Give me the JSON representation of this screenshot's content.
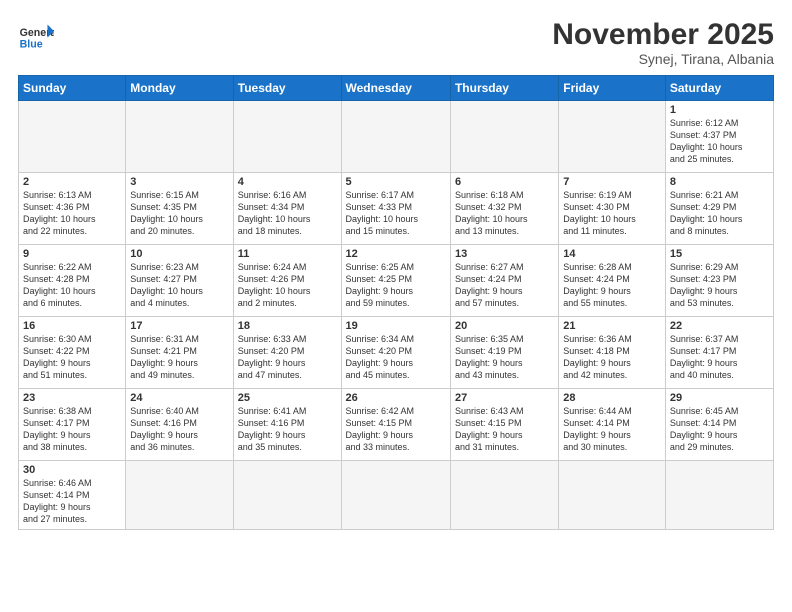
{
  "logo": {
    "line1": "General",
    "line2": "Blue"
  },
  "title": "November 2025",
  "location": "Synej, Tirana, Albania",
  "weekdays": [
    "Sunday",
    "Monday",
    "Tuesday",
    "Wednesday",
    "Thursday",
    "Friday",
    "Saturday"
  ],
  "weeks": [
    [
      {
        "day": "",
        "info": ""
      },
      {
        "day": "",
        "info": ""
      },
      {
        "day": "",
        "info": ""
      },
      {
        "day": "",
        "info": ""
      },
      {
        "day": "",
        "info": ""
      },
      {
        "day": "",
        "info": ""
      },
      {
        "day": "1",
        "info": "Sunrise: 6:12 AM\nSunset: 4:37 PM\nDaylight: 10 hours\nand 25 minutes."
      }
    ],
    [
      {
        "day": "2",
        "info": "Sunrise: 6:13 AM\nSunset: 4:36 PM\nDaylight: 10 hours\nand 22 minutes."
      },
      {
        "day": "3",
        "info": "Sunrise: 6:15 AM\nSunset: 4:35 PM\nDaylight: 10 hours\nand 20 minutes."
      },
      {
        "day": "4",
        "info": "Sunrise: 6:16 AM\nSunset: 4:34 PM\nDaylight: 10 hours\nand 18 minutes."
      },
      {
        "day": "5",
        "info": "Sunrise: 6:17 AM\nSunset: 4:33 PM\nDaylight: 10 hours\nand 15 minutes."
      },
      {
        "day": "6",
        "info": "Sunrise: 6:18 AM\nSunset: 4:32 PM\nDaylight: 10 hours\nand 13 minutes."
      },
      {
        "day": "7",
        "info": "Sunrise: 6:19 AM\nSunset: 4:30 PM\nDaylight: 10 hours\nand 11 minutes."
      },
      {
        "day": "8",
        "info": "Sunrise: 6:21 AM\nSunset: 4:29 PM\nDaylight: 10 hours\nand 8 minutes."
      }
    ],
    [
      {
        "day": "9",
        "info": "Sunrise: 6:22 AM\nSunset: 4:28 PM\nDaylight: 10 hours\nand 6 minutes."
      },
      {
        "day": "10",
        "info": "Sunrise: 6:23 AM\nSunset: 4:27 PM\nDaylight: 10 hours\nand 4 minutes."
      },
      {
        "day": "11",
        "info": "Sunrise: 6:24 AM\nSunset: 4:26 PM\nDaylight: 10 hours\nand 2 minutes."
      },
      {
        "day": "12",
        "info": "Sunrise: 6:25 AM\nSunset: 4:25 PM\nDaylight: 9 hours\nand 59 minutes."
      },
      {
        "day": "13",
        "info": "Sunrise: 6:27 AM\nSunset: 4:24 PM\nDaylight: 9 hours\nand 57 minutes."
      },
      {
        "day": "14",
        "info": "Sunrise: 6:28 AM\nSunset: 4:24 PM\nDaylight: 9 hours\nand 55 minutes."
      },
      {
        "day": "15",
        "info": "Sunrise: 6:29 AM\nSunset: 4:23 PM\nDaylight: 9 hours\nand 53 minutes."
      }
    ],
    [
      {
        "day": "16",
        "info": "Sunrise: 6:30 AM\nSunset: 4:22 PM\nDaylight: 9 hours\nand 51 minutes."
      },
      {
        "day": "17",
        "info": "Sunrise: 6:31 AM\nSunset: 4:21 PM\nDaylight: 9 hours\nand 49 minutes."
      },
      {
        "day": "18",
        "info": "Sunrise: 6:33 AM\nSunset: 4:20 PM\nDaylight: 9 hours\nand 47 minutes."
      },
      {
        "day": "19",
        "info": "Sunrise: 6:34 AM\nSunset: 4:20 PM\nDaylight: 9 hours\nand 45 minutes."
      },
      {
        "day": "20",
        "info": "Sunrise: 6:35 AM\nSunset: 4:19 PM\nDaylight: 9 hours\nand 43 minutes."
      },
      {
        "day": "21",
        "info": "Sunrise: 6:36 AM\nSunset: 4:18 PM\nDaylight: 9 hours\nand 42 minutes."
      },
      {
        "day": "22",
        "info": "Sunrise: 6:37 AM\nSunset: 4:17 PM\nDaylight: 9 hours\nand 40 minutes."
      }
    ],
    [
      {
        "day": "23",
        "info": "Sunrise: 6:38 AM\nSunset: 4:17 PM\nDaylight: 9 hours\nand 38 minutes."
      },
      {
        "day": "24",
        "info": "Sunrise: 6:40 AM\nSunset: 4:16 PM\nDaylight: 9 hours\nand 36 minutes."
      },
      {
        "day": "25",
        "info": "Sunrise: 6:41 AM\nSunset: 4:16 PM\nDaylight: 9 hours\nand 35 minutes."
      },
      {
        "day": "26",
        "info": "Sunrise: 6:42 AM\nSunset: 4:15 PM\nDaylight: 9 hours\nand 33 minutes."
      },
      {
        "day": "27",
        "info": "Sunrise: 6:43 AM\nSunset: 4:15 PM\nDaylight: 9 hours\nand 31 minutes."
      },
      {
        "day": "28",
        "info": "Sunrise: 6:44 AM\nSunset: 4:14 PM\nDaylight: 9 hours\nand 30 minutes."
      },
      {
        "day": "29",
        "info": "Sunrise: 6:45 AM\nSunset: 4:14 PM\nDaylight: 9 hours\nand 29 minutes."
      }
    ],
    [
      {
        "day": "30",
        "info": "Sunrise: 6:46 AM\nSunset: 4:14 PM\nDaylight: 9 hours\nand 27 minutes."
      },
      {
        "day": "",
        "info": ""
      },
      {
        "day": "",
        "info": ""
      },
      {
        "day": "",
        "info": ""
      },
      {
        "day": "",
        "info": ""
      },
      {
        "day": "",
        "info": ""
      },
      {
        "day": "",
        "info": ""
      }
    ]
  ]
}
